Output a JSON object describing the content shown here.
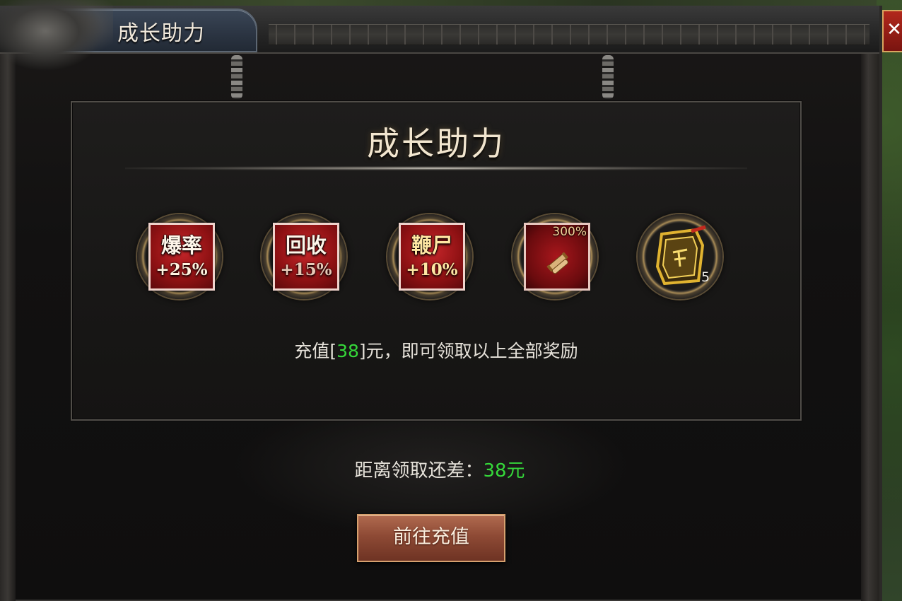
{
  "window": {
    "title": "成长助力",
    "close_glyph": "✕"
  },
  "panel": {
    "title": "成长助力",
    "rewards": [
      {
        "top": "爆率",
        "bottom": "+25%",
        "style": "white"
      },
      {
        "top": "回收",
        "bottom": "+15%",
        "style": "white"
      },
      {
        "top": "鞭尸",
        "bottom": "+10%",
        "style": "gold"
      },
      {
        "badge": "300%",
        "icon": "scroll-icon"
      },
      {
        "count": "5",
        "icon": "golden-token-icon"
      }
    ],
    "info": {
      "prefix": "充值[",
      "amount": "38",
      "suffix": "]元，即可领取以上全部奖励"
    }
  },
  "remaining": {
    "label": "距离领取还差：",
    "value": "38元"
  },
  "recharge_button": "前往充值",
  "colors": {
    "accent_green": "#35d83a",
    "button": "#8e4a35",
    "tile_red": "#b81c20"
  }
}
